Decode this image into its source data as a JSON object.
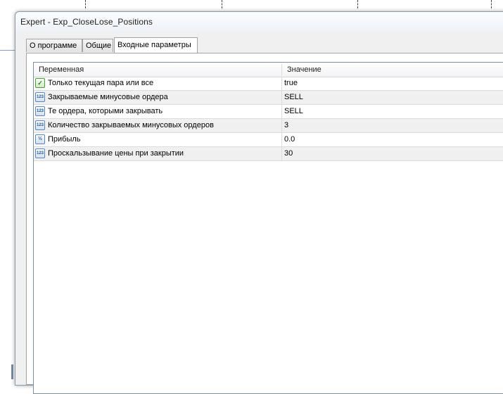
{
  "window": {
    "title": "Expert - Exp_CloseLose_Positions"
  },
  "tabs": [
    {
      "label": "О программе",
      "active": false
    },
    {
      "label": "Общие",
      "active": false
    },
    {
      "label": "Входные параметры",
      "active": true
    }
  ],
  "table": {
    "columns": [
      "Переменная",
      "Значение"
    ],
    "rows": [
      {
        "icon": "bool-icon",
        "name": "Только текущая пара или все",
        "value": "true"
      },
      {
        "icon": "int-icon",
        "name": "Закрываемые минусовые ордера",
        "value": "SELL"
      },
      {
        "icon": "int-icon",
        "name": "Те ордера, которыми закрывать",
        "value": "SELL"
      },
      {
        "icon": "int-icon",
        "name": "Количество закрываемых минусовых ордеров",
        "value": "3"
      },
      {
        "icon": "double-icon",
        "name": "Прибыль",
        "value": "0.0"
      },
      {
        "icon": "int-icon",
        "name": "Проскальзывание цены при закрытии",
        "value": "30"
      }
    ]
  },
  "icons": {
    "int_glyph": "123",
    "double_glyph": "½",
    "bool_glyph": "✓"
  }
}
